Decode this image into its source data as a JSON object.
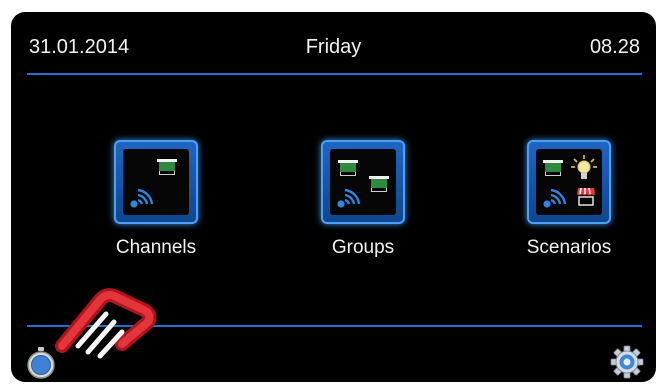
{
  "header": {
    "date": "31.01.2014",
    "day": "Friday",
    "time": "08.28"
  },
  "tiles": [
    {
      "label": "Channels",
      "icon": "single-shade-wireless-icon"
    },
    {
      "label": "Groups",
      "icon": "group-shades-wireless-icon"
    },
    {
      "label": "Scenarios",
      "icon": "scenario-shade-light-awning-icon"
    }
  ],
  "footer": {
    "timer_icon": "timer-icon",
    "settings_icon": "settings-gear-icon"
  },
  "colors": {
    "background": "#000000",
    "accent_blue": "#1f74c9",
    "tile_blue": "#1f66c2",
    "shade_green": "#2e8a3f",
    "hand_red": "#d0202a"
  }
}
